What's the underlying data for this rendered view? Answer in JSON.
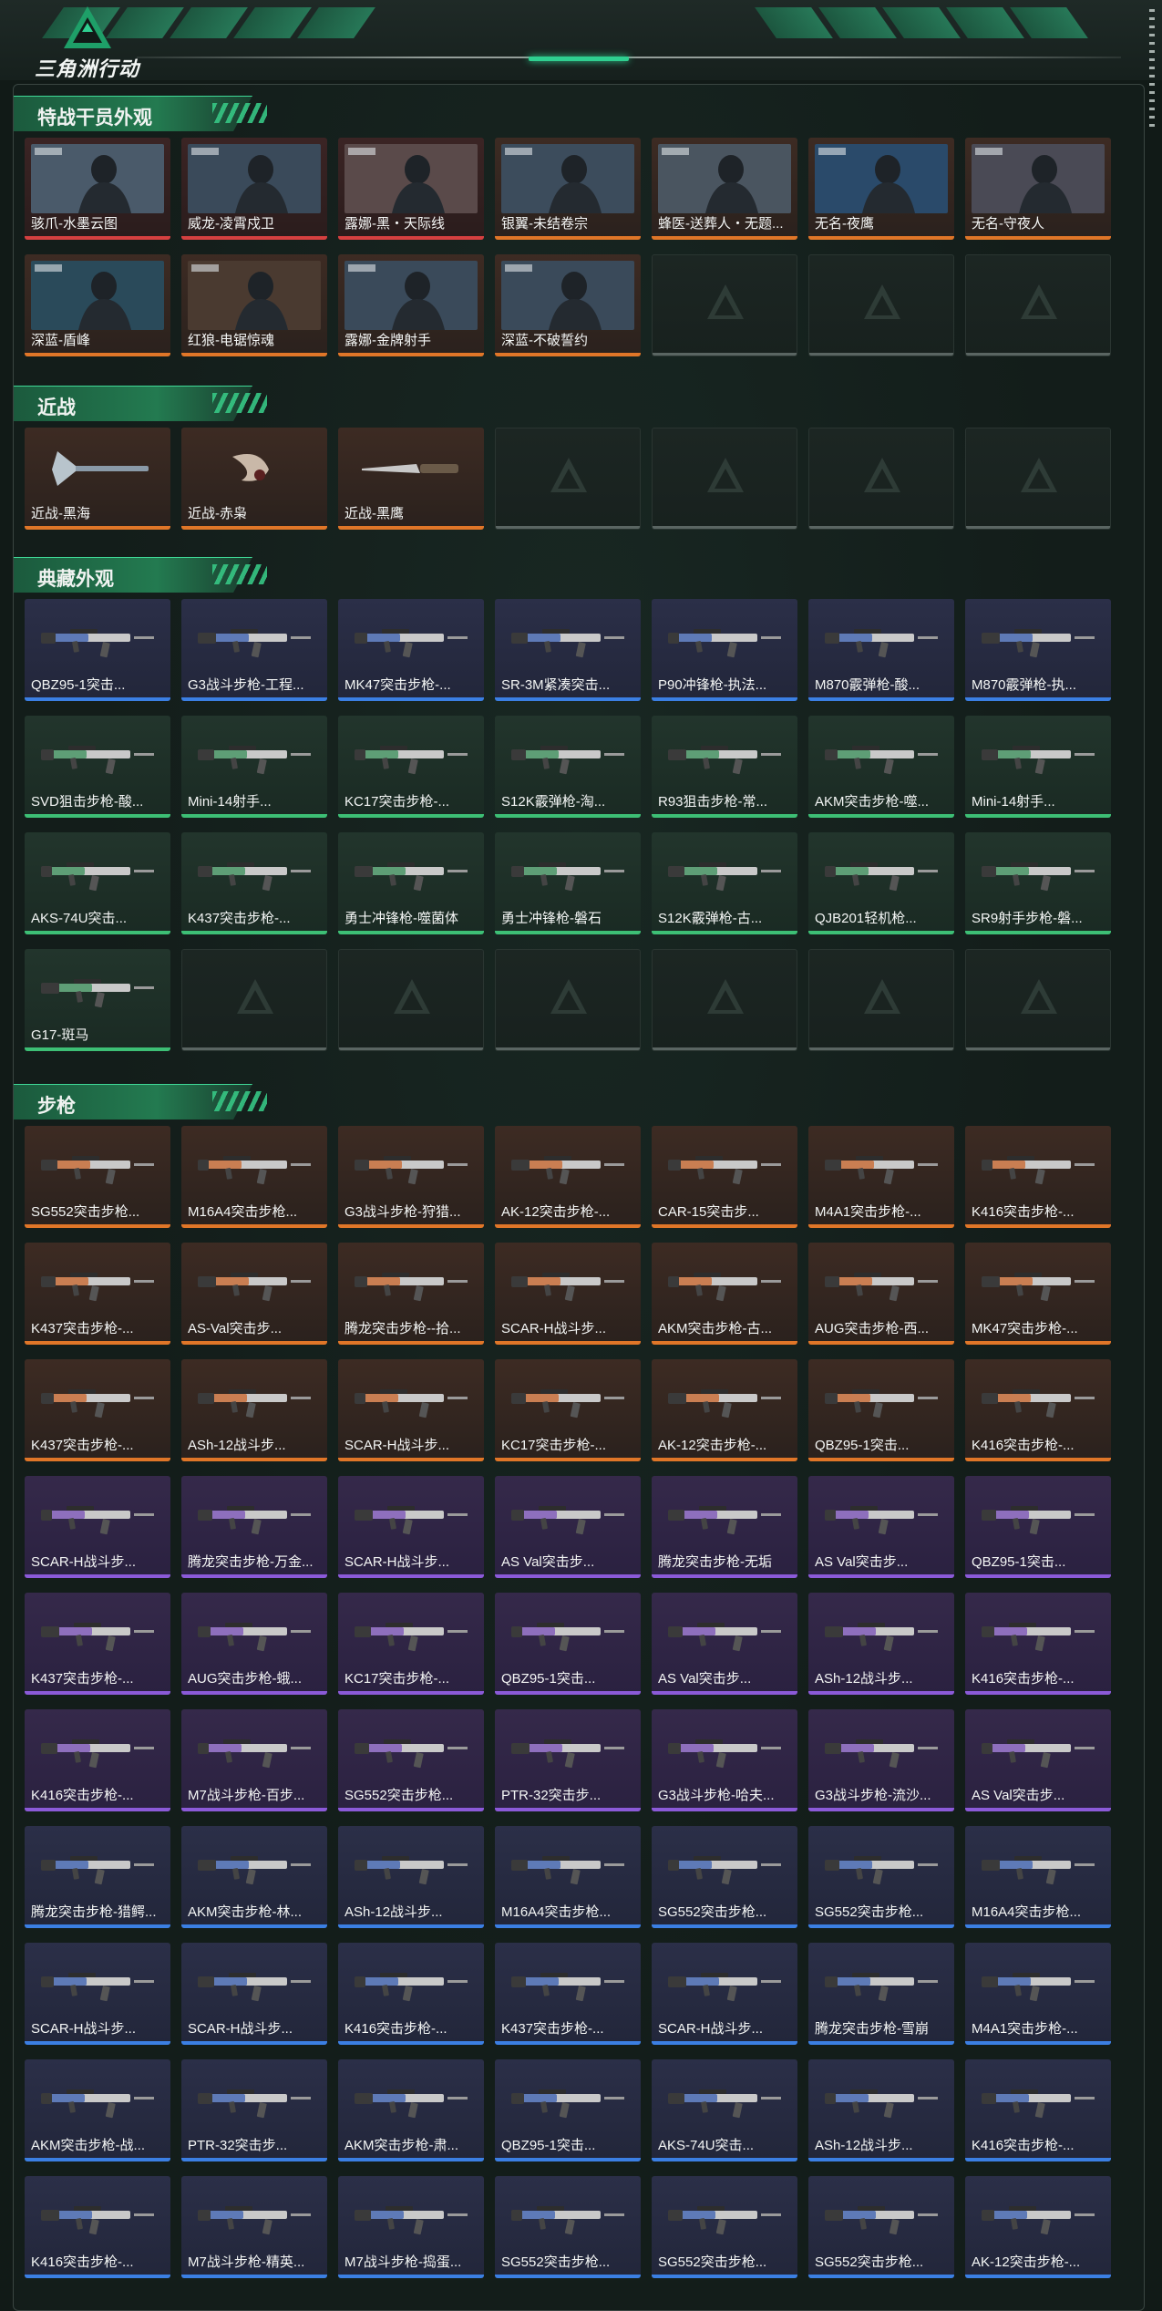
{
  "app": {
    "logo_text": "三角洲行动",
    "accent_color": "#2fcf90"
  },
  "sections": [
    {
      "title": "特战干员外观",
      "kind": "operator",
      "items": [
        {
          "label": "骇爪-水墨云图",
          "rarity": "red"
        },
        {
          "label": "威龙-凌霄戍卫",
          "rarity": "red"
        },
        {
          "label": "露娜-黑・天际线",
          "rarity": "red"
        },
        {
          "label": "银翼-未结卷宗",
          "rarity": "orange"
        },
        {
          "label": "蜂医-送葬人・无题...",
          "rarity": "orange"
        },
        {
          "label": "无名-夜鹰",
          "rarity": "orange"
        },
        {
          "label": "无名-守夜人",
          "rarity": "orange"
        },
        {
          "label": "深蓝-盾峰",
          "rarity": "orange"
        },
        {
          "label": "红狼-电锯惊魂",
          "rarity": "orange"
        },
        {
          "label": "露娜-金牌射手",
          "rarity": "orange"
        },
        {
          "label": "深蓝-不破誓约",
          "rarity": "orange"
        }
      ],
      "empty_slots": 3
    },
    {
      "title": "近战",
      "kind": "melee",
      "items": [
        {
          "label": "近战-黑海",
          "rarity": "orange"
        },
        {
          "label": "近战-赤枭",
          "rarity": "orange"
        },
        {
          "label": "近战-黑鹰",
          "rarity": "orange"
        }
      ],
      "empty_slots": 4
    },
    {
      "title": "典藏外观",
      "kind": "gun",
      "items": [
        {
          "label": "QBZ95-1突击...",
          "rarity": "blue"
        },
        {
          "label": "G3战斗步枪-工程...",
          "rarity": "blue"
        },
        {
          "label": "MK47突击步枪-...",
          "rarity": "blue"
        },
        {
          "label": "SR-3M紧凑突击...",
          "rarity": "blue"
        },
        {
          "label": "P90冲锋枪-执法...",
          "rarity": "blue"
        },
        {
          "label": "M870霰弹枪-酸...",
          "rarity": "blue"
        },
        {
          "label": "M870霰弹枪-执...",
          "rarity": "blue"
        },
        {
          "label": "SVD狙击步枪-酸...",
          "rarity": "green"
        },
        {
          "label": "Mini-14射手...",
          "rarity": "green"
        },
        {
          "label": "KC17突击步枪-...",
          "rarity": "green"
        },
        {
          "label": "S12K霰弹枪-淘...",
          "rarity": "green"
        },
        {
          "label": "R93狙击步枪-常...",
          "rarity": "green"
        },
        {
          "label": "AKM突击步枪-噬...",
          "rarity": "green"
        },
        {
          "label": "Mini-14射手...",
          "rarity": "green"
        },
        {
          "label": "AKS-74U突击...",
          "rarity": "green"
        },
        {
          "label": "K437突击步枪-...",
          "rarity": "green"
        },
        {
          "label": "勇士冲锋枪-噬菌体",
          "rarity": "green"
        },
        {
          "label": "勇士冲锋枪-磐石",
          "rarity": "green"
        },
        {
          "label": "S12K霰弹枪-古...",
          "rarity": "green"
        },
        {
          "label": "QJB201轻机枪...",
          "rarity": "green"
        },
        {
          "label": "SR9射手步枪-磐...",
          "rarity": "green"
        },
        {
          "label": "G17-斑马",
          "rarity": "green"
        }
      ],
      "empty_slots": 6
    },
    {
      "title": "步枪",
      "kind": "gun",
      "items": [
        {
          "label": "SG552突击步枪...",
          "rarity": "orange"
        },
        {
          "label": "M16A4突击步枪...",
          "rarity": "orange"
        },
        {
          "label": "G3战斗步枪-狩猎...",
          "rarity": "orange"
        },
        {
          "label": "AK-12突击步枪-...",
          "rarity": "orange"
        },
        {
          "label": "CAR-15突击步...",
          "rarity": "orange"
        },
        {
          "label": "M4A1突击步枪-...",
          "rarity": "orange"
        },
        {
          "label": "K416突击步枪-...",
          "rarity": "orange"
        },
        {
          "label": "K437突击步枪-...",
          "rarity": "orange"
        },
        {
          "label": "AS-Val突击步...",
          "rarity": "orange"
        },
        {
          "label": "腾龙突击步枪--拾...",
          "rarity": "orange"
        },
        {
          "label": "SCAR-H战斗步...",
          "rarity": "orange"
        },
        {
          "label": "AKM突击步枪-古...",
          "rarity": "orange"
        },
        {
          "label": "AUG突击步枪-西...",
          "rarity": "orange"
        },
        {
          "label": "MK47突击步枪-...",
          "rarity": "orange"
        },
        {
          "label": "K437突击步枪-...",
          "rarity": "orange"
        },
        {
          "label": "ASh-12战斗步...",
          "rarity": "orange"
        },
        {
          "label": "SCAR-H战斗步...",
          "rarity": "orange"
        },
        {
          "label": "KC17突击步枪-...",
          "rarity": "orange"
        },
        {
          "label": "AK-12突击步枪-...",
          "rarity": "orange"
        },
        {
          "label": "QBZ95-1突击...",
          "rarity": "orange"
        },
        {
          "label": "K416突击步枪-...",
          "rarity": "orange"
        },
        {
          "label": "SCAR-H战斗步...",
          "rarity": "purple"
        },
        {
          "label": "腾龙突击步枪-万金...",
          "rarity": "purple"
        },
        {
          "label": "SCAR-H战斗步...",
          "rarity": "purple"
        },
        {
          "label": "AS Val突击步...",
          "rarity": "purple"
        },
        {
          "label": "腾龙突击步枪-无垢",
          "rarity": "purple"
        },
        {
          "label": "AS Val突击步...",
          "rarity": "purple"
        },
        {
          "label": "QBZ95-1突击...",
          "rarity": "purple"
        },
        {
          "label": "K437突击步枪-...",
          "rarity": "purple"
        },
        {
          "label": "AUG突击步枪-蛾...",
          "rarity": "purple"
        },
        {
          "label": "KC17突击步枪-...",
          "rarity": "purple"
        },
        {
          "label": "QBZ95-1突击...",
          "rarity": "purple"
        },
        {
          "label": "AS Val突击步...",
          "rarity": "purple"
        },
        {
          "label": "ASh-12战斗步...",
          "rarity": "purple"
        },
        {
          "label": "K416突击步枪-...",
          "rarity": "purple"
        },
        {
          "label": "K416突击步枪-...",
          "rarity": "purple"
        },
        {
          "label": "M7战斗步枪-百步...",
          "rarity": "purple"
        },
        {
          "label": "SG552突击步枪...",
          "rarity": "purple"
        },
        {
          "label": "PTR-32突击步...",
          "rarity": "purple"
        },
        {
          "label": "G3战斗步枪-哈夫...",
          "rarity": "purple"
        },
        {
          "label": "G3战斗步枪-流沙...",
          "rarity": "purple"
        },
        {
          "label": "AS Val突击步...",
          "rarity": "purple"
        },
        {
          "label": "腾龙突击步枪-猎鳄...",
          "rarity": "blue"
        },
        {
          "label": "AKM突击步枪-林...",
          "rarity": "blue"
        },
        {
          "label": "ASh-12战斗步...",
          "rarity": "blue"
        },
        {
          "label": "M16A4突击步枪...",
          "rarity": "blue"
        },
        {
          "label": "SG552突击步枪...",
          "rarity": "blue"
        },
        {
          "label": "SG552突击步枪...",
          "rarity": "blue"
        },
        {
          "label": "M16A4突击步枪...",
          "rarity": "blue"
        },
        {
          "label": "SCAR-H战斗步...",
          "rarity": "blue"
        },
        {
          "label": "SCAR-H战斗步...",
          "rarity": "blue"
        },
        {
          "label": "K416突击步枪-...",
          "rarity": "blue"
        },
        {
          "label": "K437突击步枪-...",
          "rarity": "blue"
        },
        {
          "label": "SCAR-H战斗步...",
          "rarity": "blue"
        },
        {
          "label": "腾龙突击步枪-雪崩",
          "rarity": "blue"
        },
        {
          "label": "M4A1突击步枪-...",
          "rarity": "blue"
        },
        {
          "label": "AKM突击步枪-战...",
          "rarity": "blue"
        },
        {
          "label": "PTR-32突击步...",
          "rarity": "blue"
        },
        {
          "label": "AKM突击步枪-肃...",
          "rarity": "blue"
        },
        {
          "label": "QBZ95-1突击...",
          "rarity": "blue"
        },
        {
          "label": "AKS-74U突击...",
          "rarity": "blue"
        },
        {
          "label": "ASh-12战斗步...",
          "rarity": "blue"
        },
        {
          "label": "K416突击步枪-...",
          "rarity": "blue"
        },
        {
          "label": "K416突击步枪-...",
          "rarity": "blue"
        },
        {
          "label": "M7战斗步枪-精英...",
          "rarity": "blue"
        },
        {
          "label": "M7战斗步枪-捣蛋...",
          "rarity": "blue"
        },
        {
          "label": "SG552突击步枪...",
          "rarity": "blue"
        },
        {
          "label": "SG552突击步枪...",
          "rarity": "blue"
        },
        {
          "label": "SG552突击步枪...",
          "rarity": "blue"
        },
        {
          "label": "AK-12突击步枪-...",
          "rarity": "blue"
        }
      ],
      "empty_slots": 0
    }
  ]
}
